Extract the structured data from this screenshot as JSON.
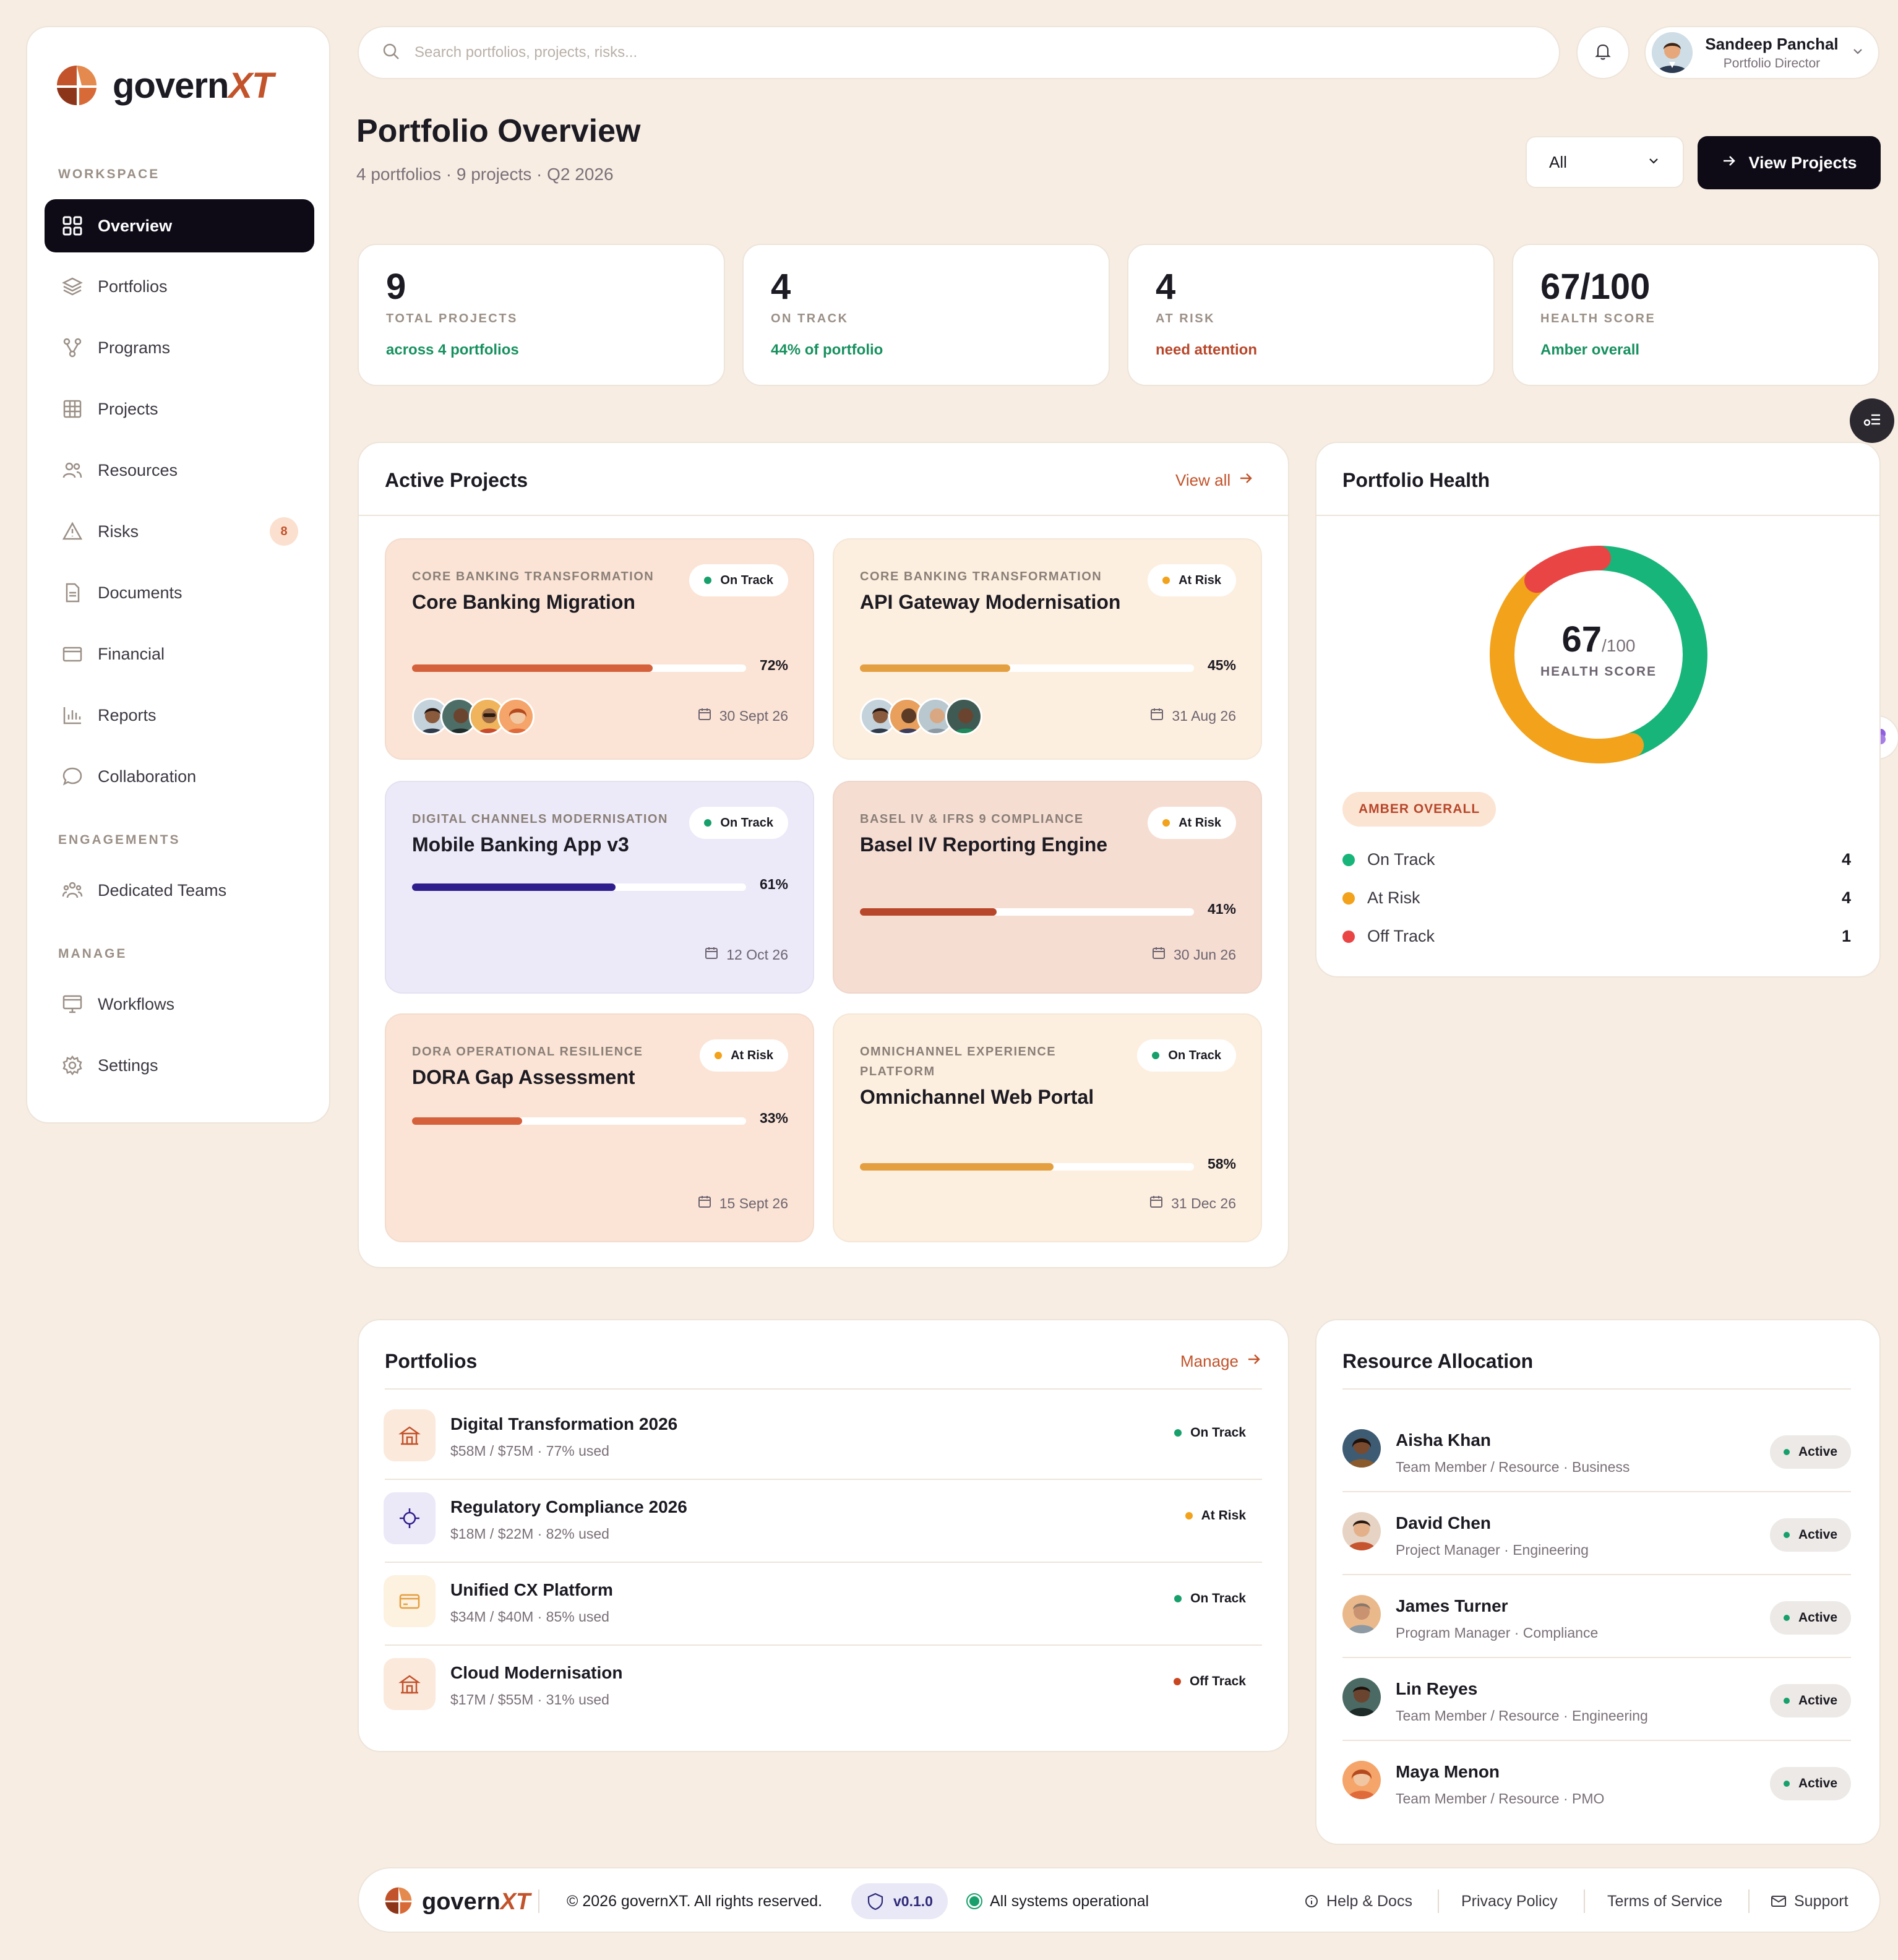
{
  "brand": {
    "name_main": "govern",
    "name_accent": "XT"
  },
  "sidebar": {
    "sections": [
      {
        "label": "WORKSPACE"
      },
      {
        "label": "ENGAGEMENTS"
      },
      {
        "label": "MANAGE"
      }
    ],
    "items": [
      {
        "label": "Overview",
        "icon": "grid-icon",
        "active": true
      },
      {
        "label": "Portfolios",
        "icon": "layers-icon"
      },
      {
        "label": "Programs",
        "icon": "hierarchy-icon"
      },
      {
        "label": "Projects",
        "icon": "table-icon"
      },
      {
        "label": "Resources",
        "icon": "users-icon"
      },
      {
        "label": "Risks",
        "icon": "warning-icon",
        "badge": "8"
      },
      {
        "label": "Documents",
        "icon": "document-icon"
      },
      {
        "label": "Financial",
        "icon": "card-icon"
      },
      {
        "label": "Reports",
        "icon": "bar-chart-icon"
      },
      {
        "label": "Collaboration",
        "icon": "chat-icon"
      },
      {
        "label": "Dedicated Teams",
        "icon": "team-icon"
      },
      {
        "label": "Workflows",
        "icon": "monitor-icon"
      },
      {
        "label": "Settings",
        "icon": "gear-icon"
      }
    ]
  },
  "topbar": {
    "search_placeholder": "Search portfolios, projects, risks...",
    "user_name": "Sandeep Panchal",
    "user_role": "Portfolio Director"
  },
  "header": {
    "title": "Portfolio Overview",
    "subtitle": "4 portfolios · 9 projects · Q2 2026",
    "filter_value": "All",
    "cta_label": "View Projects"
  },
  "stats": [
    {
      "value": "9",
      "label": "TOTAL PROJECTS",
      "sub": "across 4 portfolios",
      "sub_color": "#17905f"
    },
    {
      "value": "4",
      "label": "ON TRACK",
      "sub": "44% of portfolio",
      "sub_color": "#17905f"
    },
    {
      "value": "4",
      "label": "AT RISK",
      "sub": "need attention",
      "sub_color": "#b8462a"
    },
    {
      "value": "67/100",
      "label": "HEALTH SCORE",
      "sub": "Amber overall",
      "sub_color": "#17905f"
    }
  ],
  "active_projects": {
    "title": "Active Projects",
    "link_label": "View all",
    "projects": [
      {
        "category": "CORE BANKING TRANSFORMATION",
        "name": "Core Banking Migration",
        "status": "On Track",
        "progress": 72,
        "progress_label": "72%",
        "due": "30 Sept 26",
        "bg": "#fbe4d5",
        "bar": "#d5603c"
      },
      {
        "category": "CORE BANKING TRANSFORMATION",
        "name": "API Gateway Modernisation",
        "status": "At Risk",
        "progress": 45,
        "progress_label": "45%",
        "due": "31 Aug 26",
        "bg": "#fdefdf",
        "bar": "#e4a040"
      },
      {
        "category": "DIGITAL CHANNELS MODERNISATION",
        "name": "Mobile Banking App v3",
        "status": "On Track",
        "progress": 61,
        "progress_label": "61%",
        "due": "12 Oct 26",
        "bg": "#ece9f8",
        "bar": "#2e1d8c"
      },
      {
        "category": "BASEL IV & IFRS 9 COMPLIANCE",
        "name": "Basel IV Reporting Engine",
        "status": "At Risk",
        "progress": 41,
        "progress_label": "41%",
        "due": "30 Jun 26",
        "bg": "#f6ddd2",
        "bar": "#b8462a"
      },
      {
        "category": "DORA OPERATIONAL RESILIENCE",
        "name": "DORA Gap Assessment",
        "status": "At Risk",
        "progress": 33,
        "progress_label": "33%",
        "due": "15 Sept 26",
        "bg": "#fbe4d5",
        "bar": "#d5603c"
      },
      {
        "category": "OMNICHANNEL EXPERIENCE PLATFORM",
        "name": "Omnichannel Web Portal",
        "status": "On Track",
        "progress": 58,
        "progress_label": "58%",
        "due": "31 Dec 26",
        "bg": "#fdefdf",
        "bar": "#e4a040"
      }
    ]
  },
  "health": {
    "title": "Portfolio Health",
    "score": "67",
    "score_suffix": "/100",
    "score_label": "HEALTH SCORE",
    "badge": "AMBER OVERALL",
    "legend": [
      {
        "label": "On Track",
        "count": "4",
        "color": "#17b57a"
      },
      {
        "label": "At Risk",
        "count": "4",
        "color": "#f2a21b"
      },
      {
        "label": "Off Track",
        "count": "1",
        "color": "#ea4545"
      }
    ]
  },
  "portfolios": {
    "title": "Portfolios",
    "link_label": "Manage",
    "items": [
      {
        "name": "Digital Transformation 2026",
        "meta": "$58M / $75M · 77% used",
        "status": "On Track",
        "status_color": "#17a06b",
        "icon": "bank-icon",
        "icon_bg": "#fbe9dc"
      },
      {
        "name": "Regulatory Compliance 2026",
        "meta": "$18M / $22M · 82% used",
        "status": "At Risk",
        "status_color": "#f2a21b",
        "icon": "target-icon",
        "icon_bg": "#ebe9f8"
      },
      {
        "name": "Unified CX Platform",
        "meta": "$34M / $40M · 85% used",
        "status": "On Track",
        "status_color": "#17a06b",
        "icon": "card-icon",
        "icon_bg": "#fdf1e0"
      },
      {
        "name": "Cloud Modernisation",
        "meta": "$17M / $55M · 31% used",
        "status": "Off Track",
        "status_color": "#c9471f",
        "icon": "bank-icon",
        "icon_bg": "#fbe9dc"
      }
    ]
  },
  "resources": {
    "title": "Resource Allocation",
    "items": [
      {
        "name": "Aisha Khan",
        "role": "Team Member / Resource · Business",
        "status": "Active"
      },
      {
        "name": "David Chen",
        "role": "Project Manager · Engineering",
        "status": "Active"
      },
      {
        "name": "James Turner",
        "role": "Program Manager · Compliance",
        "status": "Active"
      },
      {
        "name": "Lin Reyes",
        "role": "Team Member / Resource · Engineering",
        "status": "Active"
      },
      {
        "name": "Maya Menon",
        "role": "Team Member / Resource · PMO",
        "status": "Active"
      }
    ]
  },
  "footer": {
    "copyright": "© 2026 governXT. All rights reserved.",
    "version": "v0.1.0",
    "system_status": "All systems operational",
    "links": [
      "Help & Docs",
      "Privacy Policy",
      "Terms of Service",
      "Support"
    ]
  },
  "colors": {
    "on_track": "#17a06b",
    "at_risk": "#f2a21b",
    "off_track": "#ea4545",
    "accent": "#c2532b",
    "dark": "#0e0b17"
  }
}
